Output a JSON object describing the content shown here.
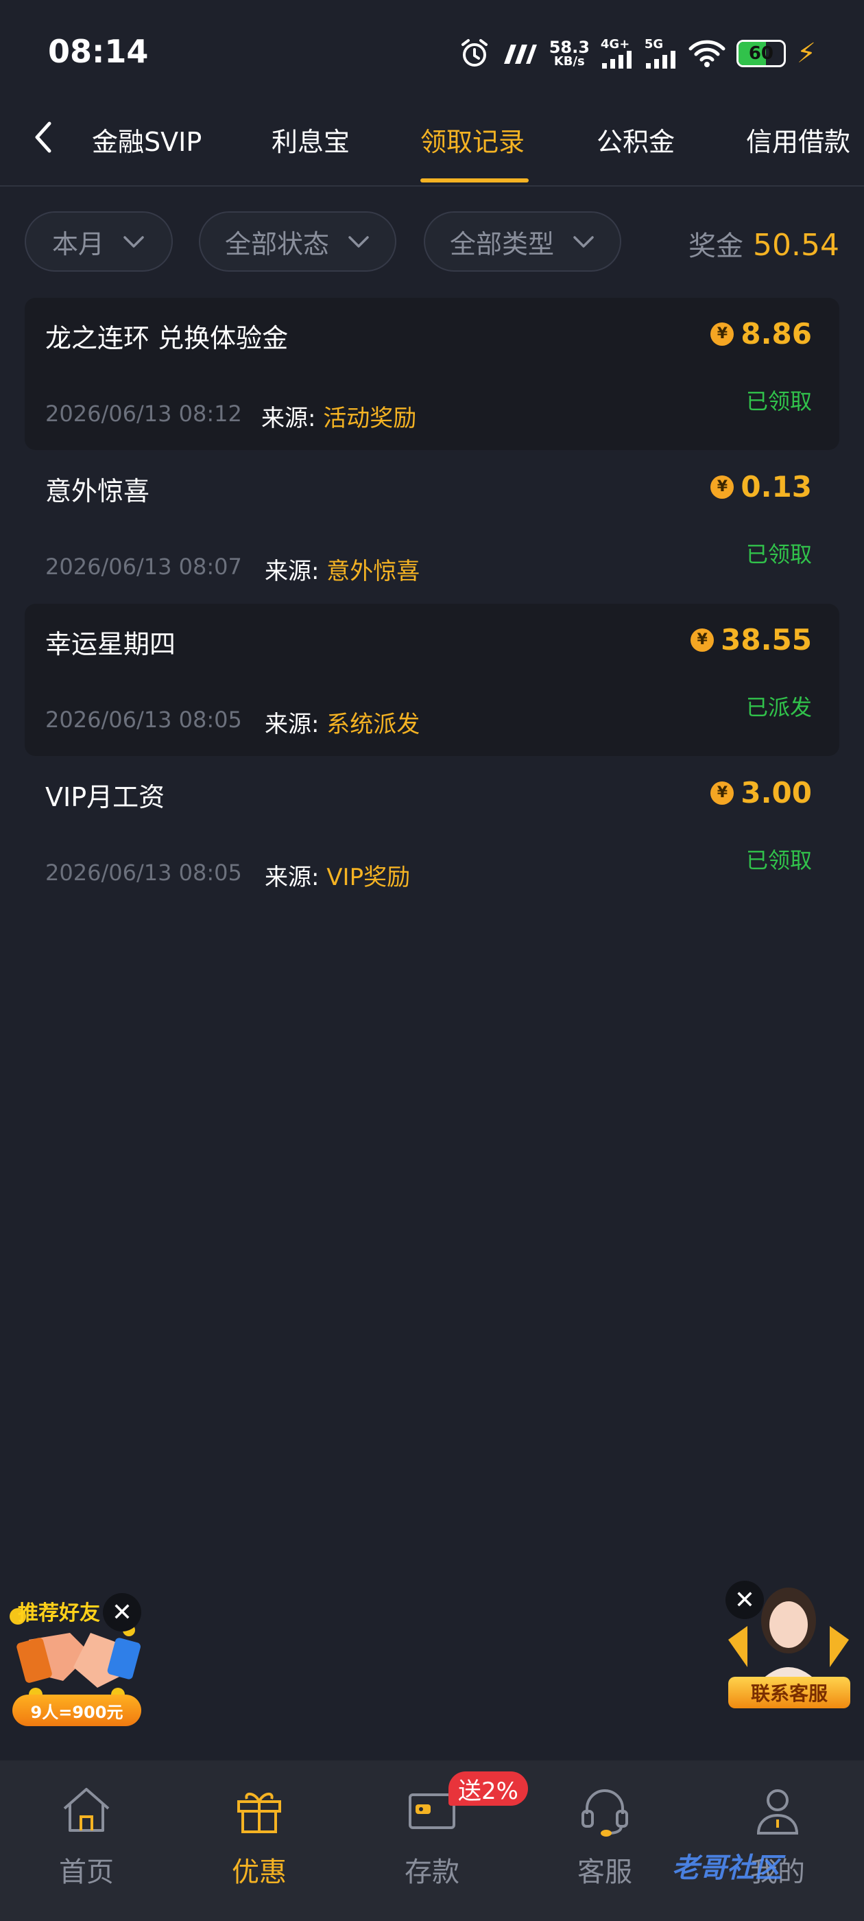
{
  "status_bar": {
    "time": "08:14",
    "speed_value": "58.3",
    "speed_unit": "KB/s",
    "net1": "4G+",
    "net2": "5G",
    "battery": "60",
    "battery_level": 0.6,
    "icons": [
      "alarm-icon",
      "m-app-icon",
      "signal-icon",
      "signal-icon",
      "wifi-icon",
      "battery-icon",
      "charging-bolt-icon"
    ]
  },
  "tabs": {
    "items": [
      {
        "label": "金融SVIP"
      },
      {
        "label": "利息宝"
      },
      {
        "label": "领取记录"
      },
      {
        "label": "公积金"
      },
      {
        "label": "信用借款"
      }
    ],
    "active_index": 2
  },
  "filters": {
    "period": "本月",
    "status": "全部状态",
    "type": "全部类型"
  },
  "bonus": {
    "label": "奖金",
    "value": "50.54"
  },
  "records": [
    {
      "title": "龙之连环 兑换体验金",
      "amount": "8.86",
      "time": "2026/06/13 08:12",
      "source_label": "来源:",
      "source": "活动奖励",
      "status": "已领取"
    },
    {
      "title": "意外惊喜",
      "amount": "0.13",
      "time": "2026/06/13 08:07",
      "source_label": "来源:",
      "source": "意外惊喜",
      "status": "已领取"
    },
    {
      "title": "幸运星期四",
      "amount": "38.55",
      "time": "2026/06/13 08:05",
      "source_label": "来源:",
      "source": "系统派发",
      "status": "已派发"
    },
    {
      "title": "VIP月工资",
      "amount": "3.00",
      "time": "2026/06/13 08:05",
      "source_label": "来源:",
      "source": "VIP奖励",
      "status": "已领取"
    }
  ],
  "currency_symbol": "¥",
  "promo_widget": {
    "title": "推荐好友",
    "pill": "9人=900元"
  },
  "support_widget": {
    "pill": "联系客服"
  },
  "bottom_nav": {
    "items": [
      {
        "label": "首页",
        "icon": "home-icon"
      },
      {
        "label": "优惠",
        "icon": "gift-icon"
      },
      {
        "label": "存款",
        "icon": "wallet-icon"
      },
      {
        "label": "客服",
        "icon": "headset-icon"
      },
      {
        "label": "我的",
        "icon": "user-icon"
      }
    ],
    "active_index": 1,
    "deposit_badge": "送2%"
  },
  "watermark": "老哥社区",
  "colors": {
    "accent": "#f5b323",
    "success": "#31c24b",
    "background": "#1e212b",
    "badge": "#e8343b"
  }
}
